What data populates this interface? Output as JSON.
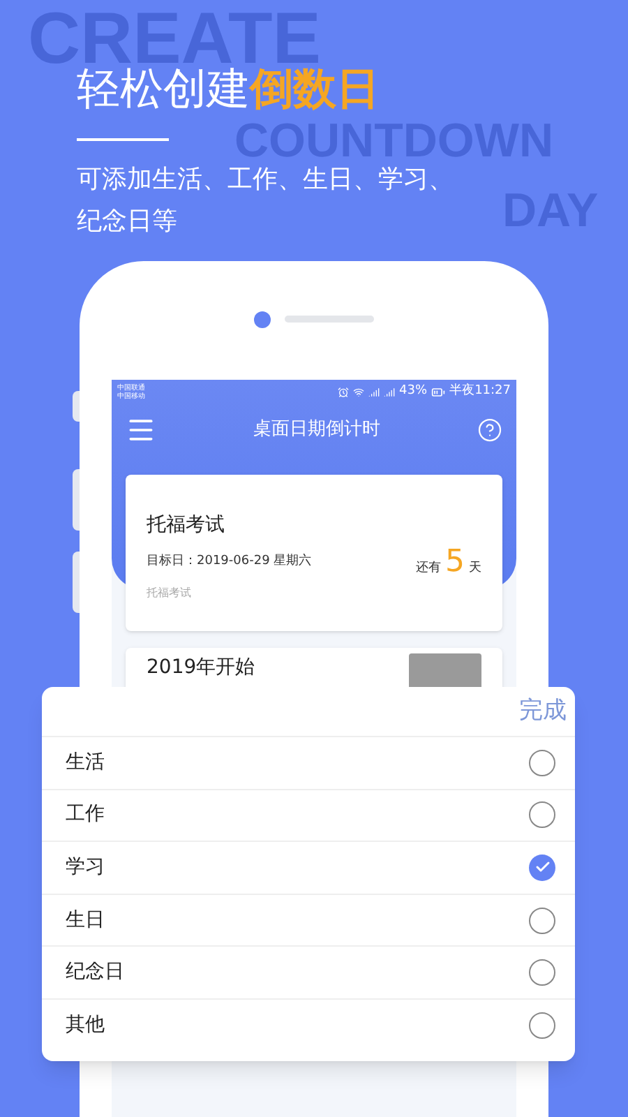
{
  "background_words": [
    "CREATE",
    "COUNTDOWN",
    "DAY"
  ],
  "headline": {
    "prefix": "轻松创建",
    "highlight": "倒数日"
  },
  "subtitle_lines": [
    "可添加生活、工作、生日、学习、",
    "纪念日等"
  ],
  "status_bar": {
    "carriers": [
      "中国联通",
      "中国移动"
    ],
    "battery": "43%",
    "time": "半夜11:27"
  },
  "app_bar": {
    "title": "桌面日期倒计时"
  },
  "event_card": {
    "title": "托福考试",
    "target_date": "目标日：2019-06-29 星期六",
    "remaining_prefix": "还有",
    "remaining_days": "5",
    "remaining_suffix": "天",
    "note": "托福考试"
  },
  "second_card": {
    "title": "2019年开始"
  },
  "picker": {
    "done": "完成",
    "options": [
      {
        "label": "生活",
        "selected": false
      },
      {
        "label": "工作",
        "selected": false
      },
      {
        "label": "学习",
        "selected": true
      },
      {
        "label": "生日",
        "selected": false
      },
      {
        "label": "纪念日",
        "selected": false
      },
      {
        "label": "其他",
        "selected": false
      }
    ]
  }
}
